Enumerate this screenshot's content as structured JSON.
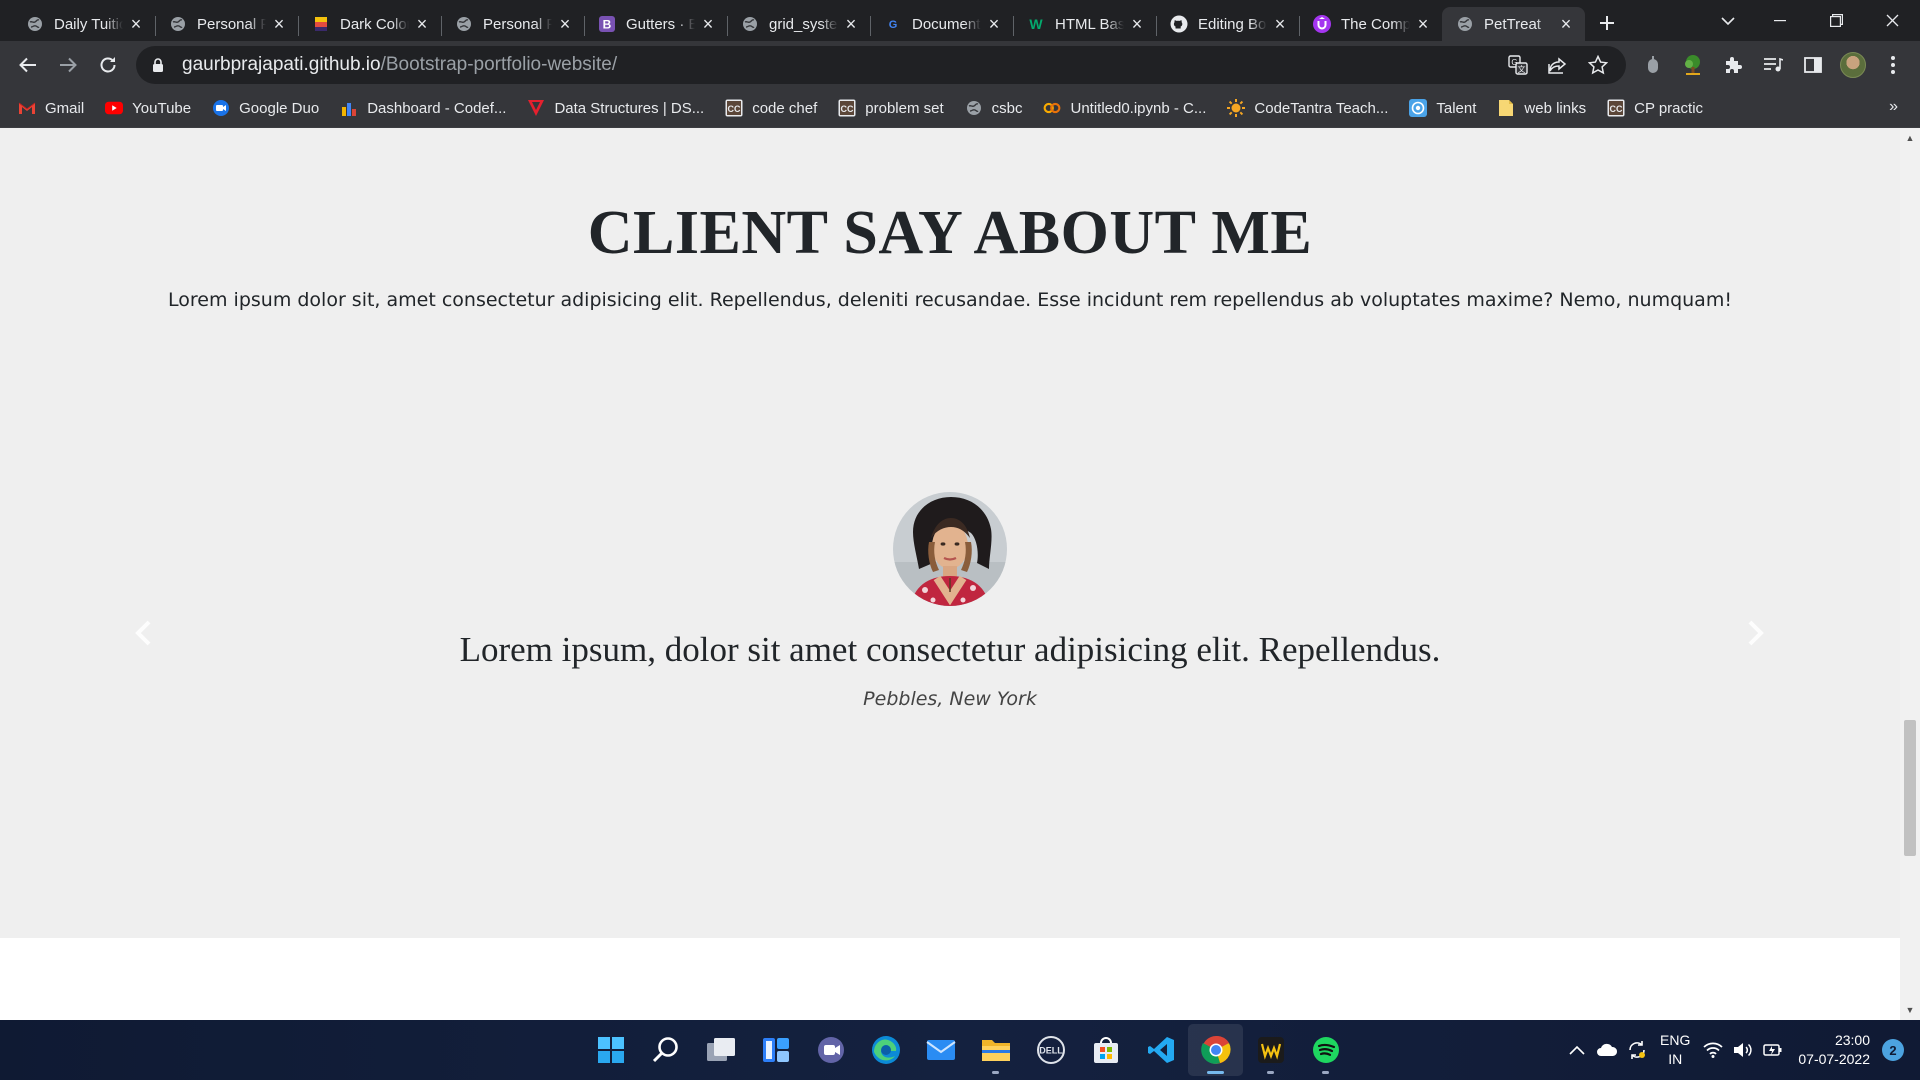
{
  "browser": {
    "tabs": [
      {
        "title": "Daily Tuition",
        "favicon": "globe-icon",
        "active": false
      },
      {
        "title": "Personal Portfolio",
        "favicon": "globe-icon",
        "active": false
      },
      {
        "title": "Dark Colors",
        "favicon": "palette-icon",
        "active": false
      },
      {
        "title": "Personal Portfolio",
        "favicon": "globe-icon",
        "active": false
      },
      {
        "title": "Gutters · Bootstrap",
        "favicon": "bootstrap-icon",
        "active": false
      },
      {
        "title": "grid_system",
        "favicon": "globe-icon",
        "active": false
      },
      {
        "title": "Document",
        "favicon": "google-icon",
        "active": false
      },
      {
        "title": "HTML Basics",
        "favicon": "w3-icon",
        "active": false
      },
      {
        "title": "Editing Bootstrap",
        "favicon": "github-icon",
        "active": false
      },
      {
        "title": "The Complete",
        "favicon": "udemy-icon",
        "active": false
      },
      {
        "title": "PetTreat",
        "favicon": "globe-icon",
        "active": true
      }
    ],
    "url": {
      "host": "gaurbprajapati.github.io",
      "path": "/Bootstrap-portfolio-website/"
    },
    "bookmarks": [
      {
        "label": "Gmail",
        "icon": "gmail-icon"
      },
      {
        "label": "YouTube",
        "icon": "youtube-icon"
      },
      {
        "label": "Google Duo",
        "icon": "duo-icon"
      },
      {
        "label": "Dashboard - Codef...",
        "icon": "chart-icon"
      },
      {
        "label": "Data Structures | DS...",
        "icon": "v-icon"
      },
      {
        "label": "code chef",
        "icon": "cc-icon"
      },
      {
        "label": "problem set",
        "icon": "cc-icon"
      },
      {
        "label": "csbc",
        "icon": "globe-icon"
      },
      {
        "label": "Untitled0.ipynb - C...",
        "icon": "colab-icon"
      },
      {
        "label": "CodeTantra Teach...",
        "icon": "sun-icon"
      },
      {
        "label": "Talent",
        "icon": "target-icon"
      },
      {
        "label": "web links",
        "icon": "folder-icon"
      },
      {
        "label": "CP practic",
        "icon": "cc-icon"
      }
    ],
    "more_bookmarks": "»"
  },
  "page": {
    "heading": "CLIENT SAY ABOUT ME",
    "lead": "Lorem ipsum dolor sit, amet consectetur adipisicing elit. Repellendus, deleniti recusandae. Esse incidunt rem repellendus ab voluptates maxime? Nemo, numquam!",
    "testimonial": {
      "quote": "Lorem ipsum, dolor sit amet consectetur adipisicing elit. Repellendus.",
      "author": "Pebbles, New York"
    }
  },
  "taskbar": {
    "apps": [
      "windows-start-icon",
      "search-icon",
      "task-view-icon",
      "widgets-icon",
      "teams-chat-icon",
      "edge-icon",
      "mail-icon",
      "file-explorer-icon",
      "dell-icon",
      "store-icon",
      "vscode-icon",
      "chrome-icon",
      "winamp-icon",
      "spotify-icon"
    ],
    "lang": {
      "line1": "ENG",
      "line2": "IN"
    },
    "time": "23:00",
    "date": "07-07-2022",
    "notifications": "2"
  },
  "colors": {
    "accent": "#76b9ed",
    "page_bg": "#efefef",
    "chrome_dark": "#202124",
    "chrome_toolbar": "#35363a"
  }
}
